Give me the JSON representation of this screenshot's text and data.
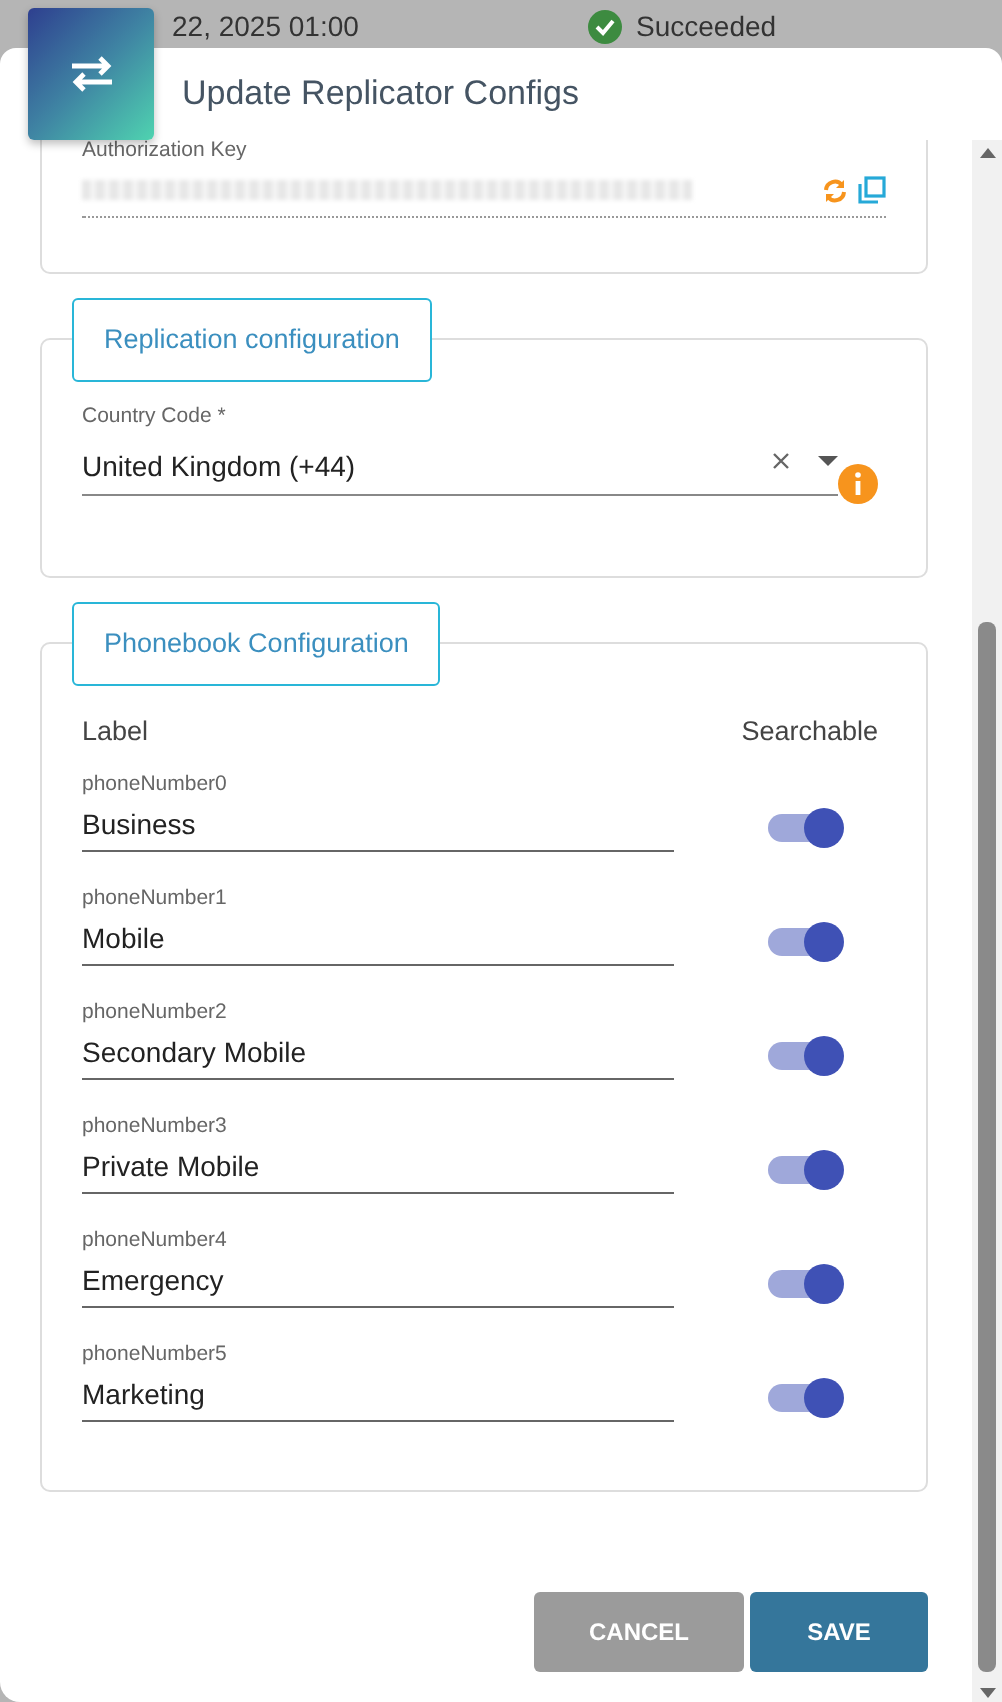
{
  "background_row": {
    "date": "22, 2025 01:00",
    "status": "Succeeded"
  },
  "dialog": {
    "title": "Update Replicator Configs"
  },
  "authorization": {
    "label": "Authorization Key"
  },
  "replication": {
    "legend": "Replication configuration",
    "country_code": {
      "label": "Country Code *",
      "value": "United Kingdom (+44)"
    }
  },
  "phonebook": {
    "legend": "Phonebook Configuration",
    "columns": [
      "Label",
      "Searchable"
    ],
    "rows": [
      {
        "name": "phoneNumber0",
        "value": "Business",
        "searchable": true
      },
      {
        "name": "phoneNumber1",
        "value": "Mobile",
        "searchable": true
      },
      {
        "name": "phoneNumber2",
        "value": "Secondary Mobile",
        "searchable": true
      },
      {
        "name": "phoneNumber3",
        "value": "Private Mobile",
        "searchable": true
      },
      {
        "name": "phoneNumber4",
        "value": "Emergency",
        "searchable": true
      },
      {
        "name": "phoneNumber5",
        "value": "Marketing",
        "searchable": true
      }
    ]
  },
  "buttons": [
    {
      "label": "CANCEL",
      "kind": "secondary"
    },
    {
      "label": "SAVE",
      "kind": "primary"
    }
  ]
}
